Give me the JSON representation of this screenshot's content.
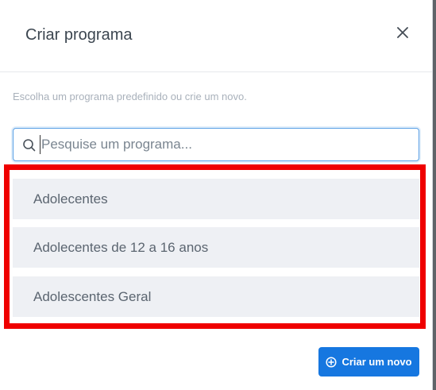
{
  "modal": {
    "title": "Criar programa",
    "subtitle": "Escolha um programa predefinido ou crie um novo."
  },
  "search": {
    "placeholder": "Pesquise um programa...",
    "value": "",
    "icon": "search-icon"
  },
  "programs": [
    {
      "label": "Adolecentes"
    },
    {
      "label": "Adolecentes de 12 a 16 anos"
    },
    {
      "label": "Adolescentes Geral"
    }
  ],
  "actions": {
    "create_label": "Criar um novo",
    "create_icon": "plus-circle-icon"
  },
  "colors": {
    "primary": "#1677e0",
    "highlight": "#ef0000",
    "item_bg": "#eef0f4"
  }
}
